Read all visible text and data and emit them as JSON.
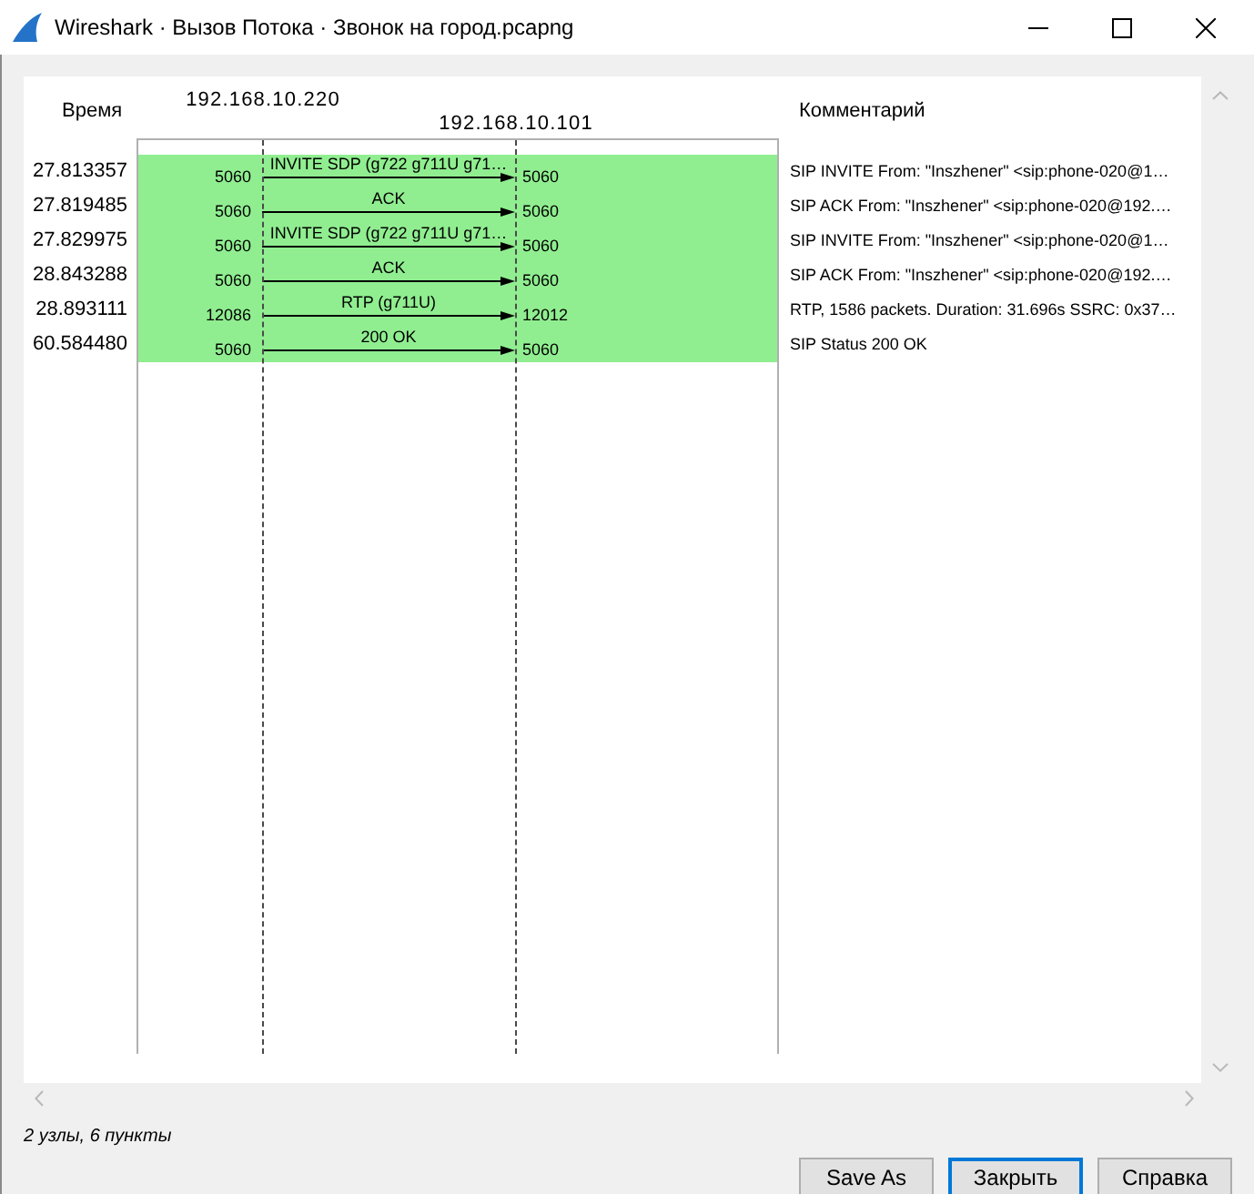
{
  "window": {
    "title": "Wireshark · Вызов Потока · Звонок на город.pcapng"
  },
  "columns": {
    "time": "Время",
    "comment": "Комментарий"
  },
  "hosts": [
    "192.168.10.220",
    "192.168.10.101"
  ],
  "flows": [
    {
      "time": "27.813357",
      "src_port": "5060",
      "label": "INVITE SDP (g722 g711U g71…",
      "dst_port": "5060",
      "comment": "SIP INVITE From: \"Inszhener\" <sip:phone-020@1…"
    },
    {
      "time": "27.819485",
      "src_port": "5060",
      "label": "ACK",
      "dst_port": "5060",
      "comment": "SIP ACK From: \"Inszhener\" <sip:phone-020@192.…"
    },
    {
      "time": "27.829975",
      "src_port": "5060",
      "label": "INVITE SDP (g722 g711U g71…",
      "dst_port": "5060",
      "comment": "SIP INVITE From: \"Inszhener\" <sip:phone-020@1…"
    },
    {
      "time": "28.843288",
      "src_port": "5060",
      "label": "ACK",
      "dst_port": "5060",
      "comment": "SIP ACK From: \"Inszhener\" <sip:phone-020@192.…"
    },
    {
      "time": "28.893111",
      "src_port": "12086",
      "label": "RTP (g711U)",
      "dst_port": "12012",
      "comment": "RTP, 1586 packets. Duration: 31.696s SSRC: 0x37…"
    },
    {
      "time": "60.584480",
      "src_port": "5060",
      "label": "200 OK",
      "dst_port": "5060",
      "comment": "SIP Status 200 OK"
    }
  ],
  "status": "2 узлы, 6 пункты",
  "buttons": [
    {
      "label": "Save As",
      "default": false
    },
    {
      "label": "Закрыть",
      "default": true
    },
    {
      "label": "Справка",
      "default": false
    }
  ]
}
